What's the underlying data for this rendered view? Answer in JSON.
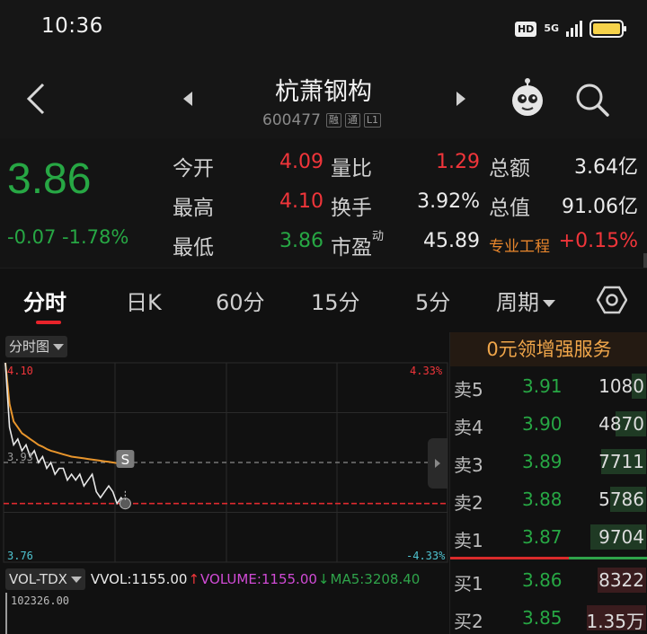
{
  "status": {
    "time": "10:36",
    "hd": "HD",
    "network": "5G"
  },
  "nav": {
    "name": "杭萧钢构",
    "code": "600477",
    "tags": [
      "融",
      "通",
      "L1"
    ]
  },
  "quote": {
    "price": "3.86",
    "change": "-0.07",
    "change_pct": "-1.78%",
    "rows": [
      {
        "l1": "今开",
        "v1": "4.09",
        "l2": "量比",
        "v2": "1.29",
        "l3": "总额",
        "v3": "3.64亿"
      },
      {
        "l1": "最高",
        "v1": "4.10",
        "l2": "换手",
        "v2": "3.92%",
        "l3": "总值",
        "v3": "91.06亿"
      },
      {
        "l1": "最低",
        "v1": "3.86",
        "l2": "市盈",
        "l2_sup": "动",
        "v2": "45.89",
        "l3": "专业工程",
        "v3": "+0.15%"
      }
    ]
  },
  "tabs": {
    "items": [
      "分时",
      "日K",
      "60分",
      "15分",
      "5分",
      "周期"
    ],
    "active": "分时"
  },
  "chart": {
    "mode_label": "分时图",
    "top_price": "4.10",
    "top_pct": "4.33%",
    "mid_price": "3.93",
    "bottom_price": "3.76",
    "bottom_pct": "-4.33%",
    "marker": "S",
    "vol_indicator": "VOL-TDX",
    "vvol": "VVOL:1155.00",
    "volume": "VOLUME:1155.00",
    "ma5": "MA5:3208.40",
    "vol_max": "102326.00"
  },
  "chart_data": {
    "type": "line",
    "title": "",
    "ylim": [
      3.76,
      4.1
    ],
    "prev_close": 3.93,
    "series": [
      {
        "name": "price",
        "values": [
          4.1,
          3.99,
          3.96,
          3.97,
          3.95,
          3.96,
          3.94,
          3.95,
          3.93,
          3.94,
          3.92,
          3.93,
          3.91,
          3.92,
          3.92,
          3.9,
          3.91,
          3.9,
          3.91,
          3.89,
          3.9,
          3.91,
          3.88,
          3.87,
          3.88,
          3.89,
          3.88,
          3.86,
          3.87,
          3.86
        ]
      },
      {
        "name": "avg",
        "values": [
          4.1,
          4.03,
          4.0,
          3.99,
          3.98,
          3.975,
          3.97,
          3.965,
          3.96,
          3.957,
          3.953,
          3.95,
          3.948,
          3.946,
          3.944,
          3.942,
          3.94,
          3.939,
          3.938,
          3.937,
          3.936,
          3.935,
          3.934,
          3.933,
          3.932,
          3.931,
          3.93,
          3.929,
          3.928,
          3.928
        ]
      }
    ]
  },
  "orderbook": {
    "promo": "0元领增强服务",
    "asks": [
      {
        "label": "卖5",
        "price": "3.91",
        "vol": "1080"
      },
      {
        "label": "卖4",
        "price": "3.90",
        "vol": "4870"
      },
      {
        "label": "卖3",
        "price": "3.89",
        "vol": "7711"
      },
      {
        "label": "卖2",
        "price": "3.88",
        "vol": "5786"
      },
      {
        "label": "卖1",
        "price": "3.87",
        "vol": "9704"
      }
    ],
    "bids": [
      {
        "label": "买1",
        "price": "3.86",
        "vol": "8322"
      },
      {
        "label": "买2",
        "price": "3.85",
        "vol": "1.35万"
      }
    ]
  },
  "colors": {
    "up": "#f0353a",
    "down": "#27a744",
    "avg_line": "#e8952c",
    "price_line": "#e8e8e8"
  }
}
